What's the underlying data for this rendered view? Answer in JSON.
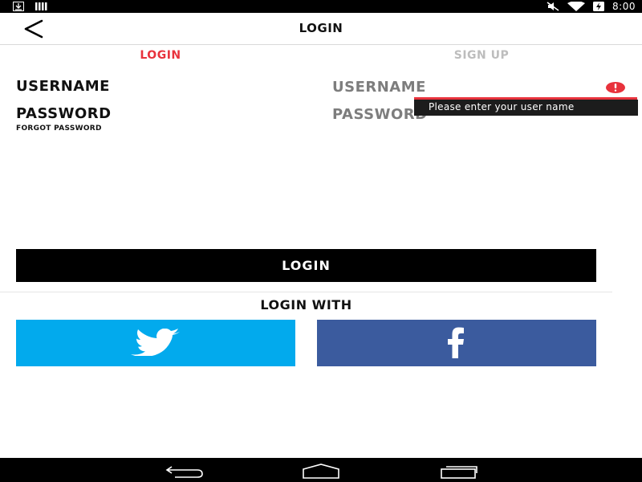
{
  "status_bar": {
    "time": "8:00",
    "icons": [
      "download-icon",
      "bars-icon",
      "mute-icon",
      "wifi-icon",
      "battery-charging-icon"
    ]
  },
  "app_bar": {
    "back_icon": "chevron-left-icon",
    "title": "LOGIN"
  },
  "tabs": {
    "login": "LOGIN",
    "signup": "SIGN UP",
    "active": "login",
    "active_color": "#e8323c",
    "inactive_color": "#bdbdbd"
  },
  "form": {
    "username_label": "USERNAME",
    "password_label": "PASSWORD",
    "forgot_password": "FORGOT PASSWORD",
    "username_placeholder": "USERNAME",
    "username_value": "",
    "password_placeholder": "PASSWORD",
    "password_value": "",
    "error_icon": "exclamation-icon",
    "error_message": "Please enter your user name",
    "error_color": "#e8323c"
  },
  "login_button": "LOGIN",
  "login_with": "LOGIN WITH",
  "social": {
    "twitter": {
      "icon": "twitter-bird-icon",
      "color": "#02aaed"
    },
    "facebook": {
      "icon": "facebook-f-icon",
      "color": "#3b5b9e"
    }
  },
  "nav_bar": {
    "icons": [
      "back-nav-icon",
      "home-nav-icon",
      "recents-nav-icon"
    ]
  }
}
